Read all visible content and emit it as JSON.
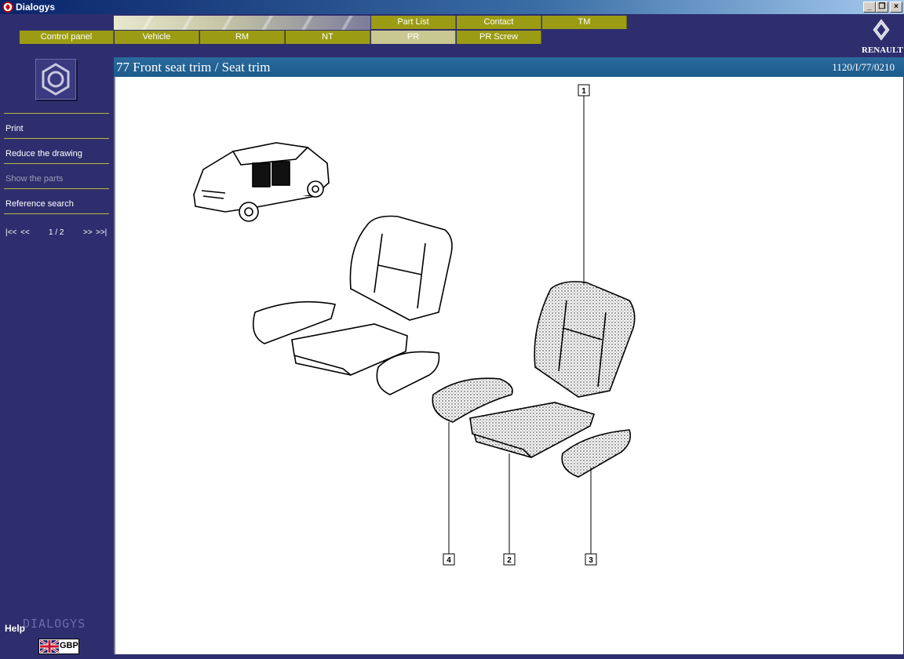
{
  "window": {
    "title": "Dialogys"
  },
  "tabs_top": [
    {
      "label": "Part List"
    },
    {
      "label": "Contact"
    },
    {
      "label": "TM"
    }
  ],
  "tabs_main": [
    {
      "label": "Control panel"
    },
    {
      "label": "Vehicle"
    },
    {
      "label": "RM"
    },
    {
      "label": "NT"
    },
    {
      "label": "PR",
      "active": true
    },
    {
      "label": "PR Screw"
    }
  ],
  "brand": {
    "wordmark": "RENAULT"
  },
  "sidebar": {
    "items": [
      {
        "label": "Print",
        "enabled": true
      },
      {
        "label": "Reduce the drawing",
        "enabled": true
      },
      {
        "label": "Show the parts",
        "enabled": false
      },
      {
        "label": "Reference search",
        "enabled": true
      }
    ],
    "pager": {
      "first": "|<<",
      "prev": "<<",
      "page": "1 / 2",
      "next": ">>",
      "last": ">>|"
    },
    "help": "Help",
    "watermark": "DIALOGYS",
    "currency": "GBP"
  },
  "content": {
    "title": "77 Front seat trim / Seat trim",
    "reference": "1120/I/77/0210"
  },
  "drawing": {
    "callouts": [
      "1",
      "2",
      "3",
      "4"
    ]
  },
  "colors": {
    "background": "#2e2e6e",
    "tab": "#9c9c14",
    "tab_active": "#c8c890",
    "header_bar": "#1c5a8c"
  }
}
